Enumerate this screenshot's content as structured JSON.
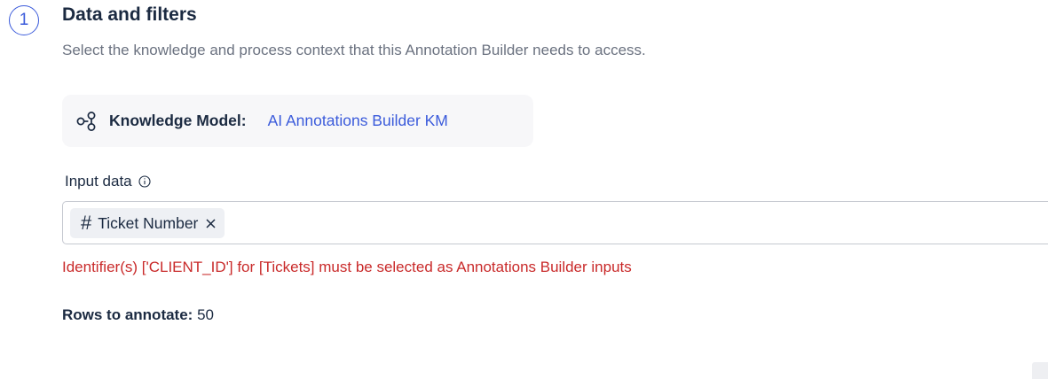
{
  "step": {
    "number": "1",
    "title": "Data and filters",
    "subtitle": "Select the knowledge and process context that this Annotation Builder needs to access."
  },
  "knowledge_model": {
    "icon": "knowledge-model-icon",
    "label": "Knowledge Model:",
    "value": "AI Annotations Builder KM",
    "value_color": "#3b5bdb"
  },
  "input_data": {
    "label": "Input data",
    "info_icon": "info-icon",
    "chips": [
      {
        "icon": "#",
        "label": "Ticket Number",
        "remove_icon": "close-icon"
      }
    ],
    "error": "Identifier(s) ['CLIENT_ID'] for [Tickets] must be selected as Annotations Builder inputs",
    "error_color": "#c92a2a"
  },
  "rows": {
    "label": "Rows to annotate:",
    "value": "50"
  },
  "colors": {
    "accent": "#3b5bdb",
    "text": "#1b2a41",
    "muted": "#6b7280"
  }
}
